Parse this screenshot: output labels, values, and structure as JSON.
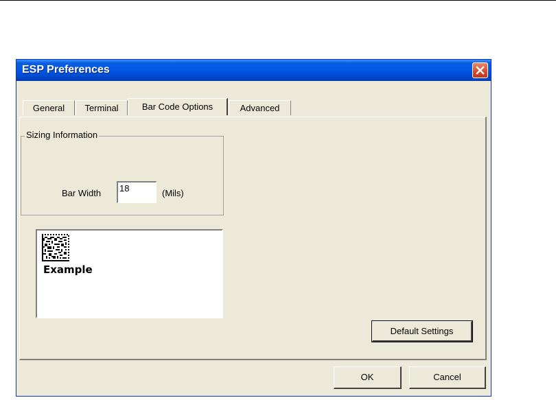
{
  "window": {
    "title": "ESP Preferences"
  },
  "tabs": [
    {
      "label": "General"
    },
    {
      "label": "Terminal"
    },
    {
      "label": "Bar Code Options"
    },
    {
      "label": "Advanced"
    }
  ],
  "active_tab": "Bar Code Options",
  "sizing": {
    "group_label": "Sizing Information",
    "bar_width_label": "Bar Width",
    "bar_width_value": "18",
    "unit_label": "(Mils)"
  },
  "preview": {
    "caption": "Example",
    "image": "datamatrix-barcode"
  },
  "buttons": {
    "default_settings": "Default Settings",
    "ok": "OK",
    "cancel": "Cancel"
  },
  "colors": {
    "titlebar": "#0055e5",
    "face": "#ece9d8",
    "close": "#d6482c"
  },
  "icons": {
    "close": "close-icon"
  }
}
